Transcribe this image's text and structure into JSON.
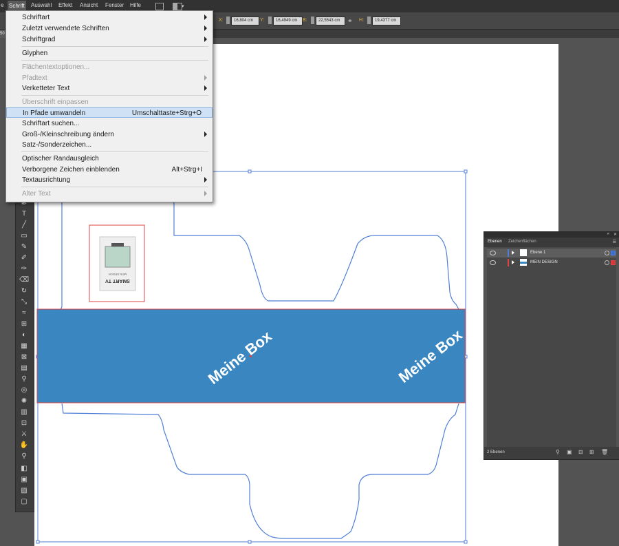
{
  "menubar": {
    "items": [
      "e",
      "Schrift",
      "Auswahl",
      "Effekt",
      "Ansicht",
      "Fenster",
      "Hilfe"
    ]
  },
  "controlbar": {
    "x_label": "X:",
    "x_value": "16,804 cm",
    "y_label": "Y:",
    "y_value": "16,4949 cm",
    "w_label": "B:",
    "w_value": "22,5543 cm",
    "h_label": "H:",
    "h_value": "19,4377 cm"
  },
  "doc_tab": "50",
  "schrift_menu": {
    "items": [
      {
        "label": "Schriftart",
        "submenu": true
      },
      {
        "label": "Zuletzt verwendete Schriften",
        "submenu": true
      },
      {
        "label": "Schriftgrad",
        "submenu": true
      },
      {
        "label": "Glyphen"
      },
      {
        "label": "Flächentextoptionen...",
        "disabled": true
      },
      {
        "label": "Pfadtext",
        "disabled": true,
        "submenu": true
      },
      {
        "label": "Verketteter Text",
        "submenu": true
      },
      {
        "label": "Überschrift einpassen",
        "disabled": true
      },
      {
        "label": "In Pfade umwandeln",
        "shortcut": "Umschalttaste+Strg+O",
        "highlighted": true
      },
      {
        "label": "Schriftart suchen..."
      },
      {
        "label": "Groß-/Kleinschreibung ändern",
        "submenu": true
      },
      {
        "label": "Satz-/Sonderzeichen..."
      },
      {
        "label": "Optischer Randausgleich"
      },
      {
        "label": "Verborgene Zeichen einblenden",
        "shortcut": "Alt+Strg+I"
      },
      {
        "label": "Textausrichtung",
        "submenu": true
      },
      {
        "label": "Alter Text",
        "disabled": true,
        "submenu": true
      }
    ]
  },
  "canvas": {
    "band_color": "#3a86c0",
    "box_text_1": "Meine Box",
    "box_text_2": "Meine Box",
    "product_image": {
      "line1": "SMART TV",
      "line2": "MEIN DESIGN"
    }
  },
  "layers_panel": {
    "tab_layers": "Ebenen",
    "tab_artboards": "Zeichenflächen",
    "layers": [
      {
        "name": "Ebene 1",
        "color": "#4f7fd6"
      },
      {
        "name": "MEIN DESIGN",
        "color": "#e04545"
      }
    ],
    "count_label": "2 Ebenen"
  }
}
